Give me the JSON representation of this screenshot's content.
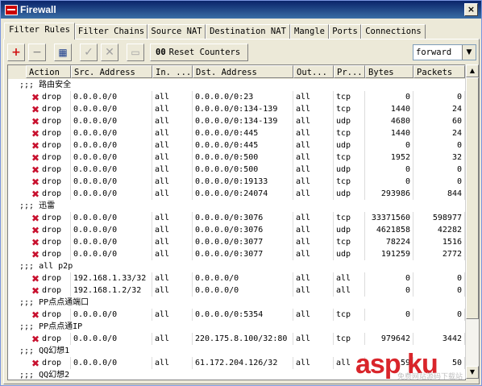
{
  "window": {
    "title": "Firewall",
    "close_glyph": "×"
  },
  "tabs": [
    {
      "label": "Filter Rules",
      "active": true
    },
    {
      "label": "Filter Chains"
    },
    {
      "label": "Source NAT"
    },
    {
      "label": "Destination NAT"
    },
    {
      "label": "Mangle"
    },
    {
      "label": "Ports"
    },
    {
      "label": "Connections"
    }
  ],
  "toolbar": {
    "add_icon": "+",
    "remove_icon": "−",
    "enable_icon": "✓",
    "disable_icon": "✕",
    "comment_icon": "▭",
    "filter_icon": "▦",
    "reset_counters_prefix": "00",
    "reset_counters_label": "Reset Counters",
    "chain_select_value": "forward",
    "select_arrow": "▼"
  },
  "table": {
    "columns": [
      "Action",
      "Src. Address",
      "In. ...",
      "Dst. Address",
      "Out...",
      "Pr...",
      "Bytes",
      "Packets"
    ],
    "rows": [
      {
        "type": "comment",
        "text": ";;; 路由安全"
      },
      {
        "type": "rule",
        "action": "drop",
        "src": "0.0.0.0/0",
        "in": "all",
        "dst": "0.0.0.0/0:23",
        "out": "all",
        "proto": "tcp",
        "bytes": "0",
        "packets": "0"
      },
      {
        "type": "rule",
        "action": "drop",
        "src": "0.0.0.0/0",
        "in": "all",
        "dst": "0.0.0.0/0:134-139",
        "out": "all",
        "proto": "tcp",
        "bytes": "1440",
        "packets": "24"
      },
      {
        "type": "rule",
        "action": "drop",
        "src": "0.0.0.0/0",
        "in": "all",
        "dst": "0.0.0.0/0:134-139",
        "out": "all",
        "proto": "udp",
        "bytes": "4680",
        "packets": "60"
      },
      {
        "type": "rule",
        "action": "drop",
        "src": "0.0.0.0/0",
        "in": "all",
        "dst": "0.0.0.0/0:445",
        "out": "all",
        "proto": "tcp",
        "bytes": "1440",
        "packets": "24"
      },
      {
        "type": "rule",
        "action": "drop",
        "src": "0.0.0.0/0",
        "in": "all",
        "dst": "0.0.0.0/0:445",
        "out": "all",
        "proto": "udp",
        "bytes": "0",
        "packets": "0"
      },
      {
        "type": "rule",
        "action": "drop",
        "src": "0.0.0.0/0",
        "in": "all",
        "dst": "0.0.0.0/0:500",
        "out": "all",
        "proto": "tcp",
        "bytes": "1952",
        "packets": "32"
      },
      {
        "type": "rule",
        "action": "drop",
        "src": "0.0.0.0/0",
        "in": "all",
        "dst": "0.0.0.0/0:500",
        "out": "all",
        "proto": "udp",
        "bytes": "0",
        "packets": "0"
      },
      {
        "type": "rule",
        "action": "drop",
        "src": "0.0.0.0/0",
        "in": "all",
        "dst": "0.0.0.0/0:19133",
        "out": "all",
        "proto": "tcp",
        "bytes": "0",
        "packets": "0"
      },
      {
        "type": "rule",
        "action": "drop",
        "src": "0.0.0.0/0",
        "in": "all",
        "dst": "0.0.0.0/0:24074",
        "out": "all",
        "proto": "udp",
        "bytes": "293986",
        "packets": "844"
      },
      {
        "type": "comment",
        "text": ";;; 迅雷"
      },
      {
        "type": "rule",
        "action": "drop",
        "src": "0.0.0.0/0",
        "in": "all",
        "dst": "0.0.0.0/0:3076",
        "out": "all",
        "proto": "tcp",
        "bytes": "33371560",
        "packets": "598977"
      },
      {
        "type": "rule",
        "action": "drop",
        "src": "0.0.0.0/0",
        "in": "all",
        "dst": "0.0.0.0/0:3076",
        "out": "all",
        "proto": "udp",
        "bytes": "4621858",
        "packets": "42282"
      },
      {
        "type": "rule",
        "action": "drop",
        "src": "0.0.0.0/0",
        "in": "all",
        "dst": "0.0.0.0/0:3077",
        "out": "all",
        "proto": "tcp",
        "bytes": "78224",
        "packets": "1516"
      },
      {
        "type": "rule",
        "action": "drop",
        "src": "0.0.0.0/0",
        "in": "all",
        "dst": "0.0.0.0/0:3077",
        "out": "all",
        "proto": "udp",
        "bytes": "191259",
        "packets": "2772"
      },
      {
        "type": "comment",
        "text": ";;; all p2p"
      },
      {
        "type": "rule",
        "action": "drop",
        "src": "192.168.1.33/32",
        "in": "all",
        "dst": "0.0.0.0/0",
        "out": "all",
        "proto": "all",
        "bytes": "0",
        "packets": "0"
      },
      {
        "type": "rule",
        "action": "drop",
        "src": "192.168.1.2/32",
        "in": "all",
        "dst": "0.0.0.0/0",
        "out": "all",
        "proto": "all",
        "bytes": "0",
        "packets": "0"
      },
      {
        "type": "comment",
        "text": ";;; PP点点通端口"
      },
      {
        "type": "rule",
        "action": "drop",
        "src": "0.0.0.0/0",
        "in": "all",
        "dst": "0.0.0.0/0:5354",
        "out": "all",
        "proto": "tcp",
        "bytes": "0",
        "packets": "0"
      },
      {
        "type": "comment",
        "text": ";;; PP点点通IP"
      },
      {
        "type": "rule",
        "action": "drop",
        "src": "0.0.0.0/0",
        "in": "all",
        "dst": "220.175.8.100/32:80",
        "out": "all",
        "proto": "tcp",
        "bytes": "979642",
        "packets": "3442"
      },
      {
        "type": "comment",
        "text": ";;; QQ幻想1"
      },
      {
        "type": "rule",
        "action": "drop",
        "src": "0.0.0.0/0",
        "in": "all",
        "dst": "61.172.204.126/32",
        "out": "all",
        "proto": "all",
        "bytes": "59",
        "packets": "50"
      },
      {
        "type": "comment",
        "text": ";;; QQ幻想2"
      }
    ]
  },
  "scrollbar": {
    "up_glyph": "▲",
    "down_glyph": "▼"
  },
  "watermark": {
    "text": "asp ku",
    "subtext": "免费网站源码下载站"
  }
}
